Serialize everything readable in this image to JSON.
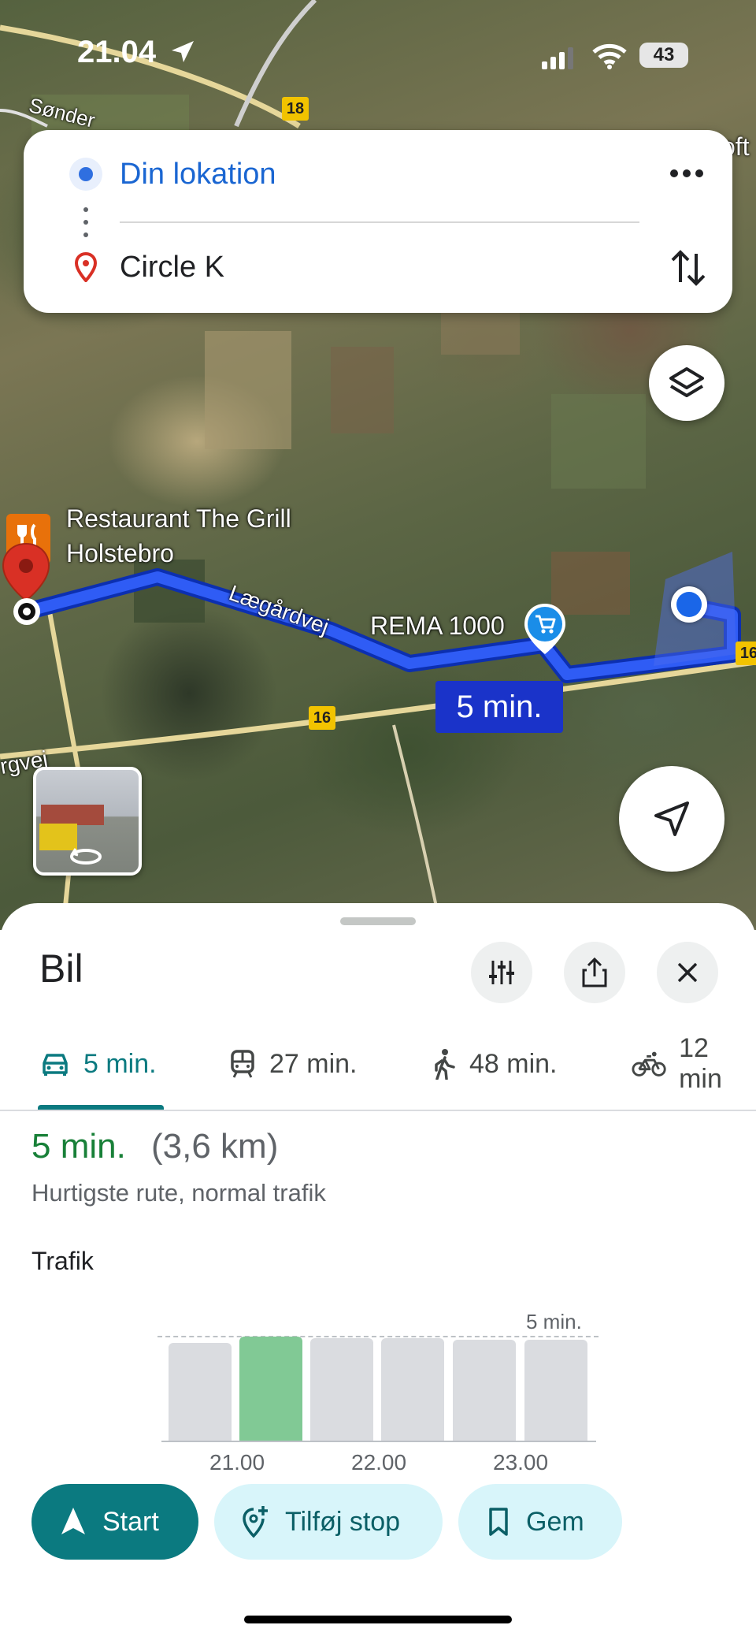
{
  "status_bar": {
    "time": "21.04",
    "battery": "43"
  },
  "search": {
    "origin": "Din lokation",
    "destination": "Circle K"
  },
  "map": {
    "labels": {
      "poi_restaurant_line1": "Restaurant The Grill",
      "poi_restaurant_line2": "Holstebro",
      "poi_store": "REMA 1000",
      "street_laegardvej": "Lægårdvej",
      "street_sonder": "Sønder",
      "street_rgvej": "rgvej",
      "edge_oft": "oft",
      "road_18": "18",
      "road_16_a": "16",
      "road_16_b": "16"
    },
    "route_badge": "5 min.",
    "route_color": "#1a33c9"
  },
  "sheet": {
    "title": "Bil",
    "tabs": [
      {
        "label": "5 min.",
        "icon": "car-icon"
      },
      {
        "label": "27 min.",
        "icon": "train-icon"
      },
      {
        "label": "48 min.",
        "icon": "walking-icon"
      },
      {
        "label": "12 min",
        "icon": "bicycle-icon"
      }
    ],
    "eta": "5 min.",
    "distance": "(3,6 km)",
    "route_description": "Hurtigste rute, normal trafik",
    "traffic_title": "Trafik",
    "traffic_chart": {
      "max_label": "5 min.",
      "hours": [
        "21.00",
        "22.00",
        "23.00"
      ],
      "active_index": 1
    }
  },
  "actions": {
    "start": "Start",
    "add_stop": "Tilføj stop",
    "save": "Gem"
  },
  "colors": {
    "accent": "#0b7a80",
    "eta_green": "#188038",
    "origin_blue": "#1a66d2",
    "pin_red": "#d93025"
  }
}
